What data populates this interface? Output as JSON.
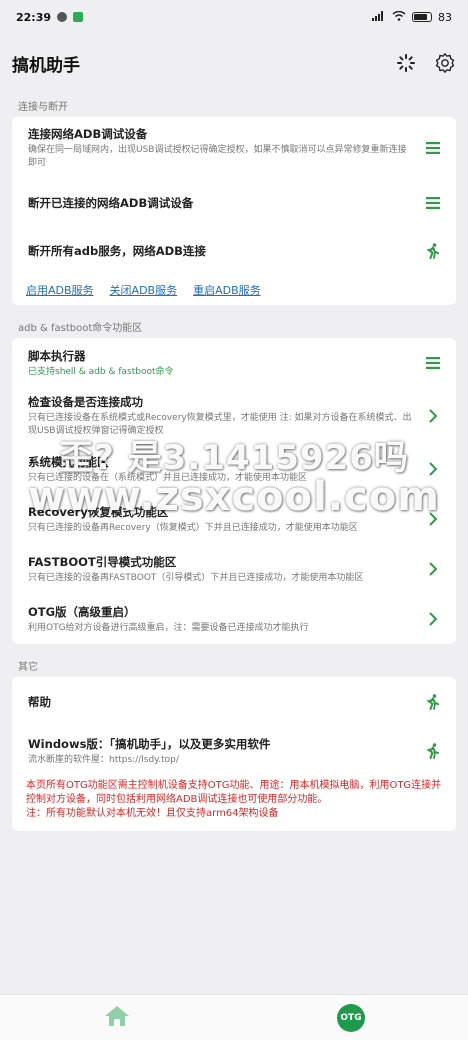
{
  "status_bar": {
    "time": "22:39",
    "battery": "83"
  },
  "app": {
    "title": "搞机助手",
    "loading_icon": "loading-icon",
    "settings_icon": "gear-icon"
  },
  "sections": {
    "connect": {
      "label": "连接与断开",
      "items": [
        {
          "title": "连接网络ADB调试设备",
          "subtitle": "确保在同一局域网内，出现USB调试授权记得确定授权，如果不慎取消可以点异常修复重新连接即可",
          "icon": "menu-icon"
        },
        {
          "title": "断开已连接的网络ADB调试设备",
          "subtitle": "",
          "icon": "menu-icon"
        },
        {
          "title": "断开所有adb服务，网络ADB连接",
          "subtitle": "",
          "icon": "run-icon"
        }
      ],
      "links": [
        "启用ADB服务",
        "关闭ADB服务",
        "重启ADB服务"
      ]
    },
    "adb": {
      "label": "adb & fastboot命令功能区",
      "items": [
        {
          "title": "脚本执行器",
          "subtitle": "已支持shell & adb & fastboot命令",
          "icon": "menu-icon"
        },
        {
          "title": "检查设备是否连接成功",
          "subtitle": "只有已连接设备在系统模式或Recovery恢复模式里，才能使用 注: 如果对方设备在系统模式、出现USB调试授权弹窗记得确定授权",
          "icon": "chevron-right-icon"
        },
        {
          "title": "系统模式功能区",
          "subtitle": "只有已连接的设备在（系统模式）并且已连接成功，才能使用本功能区",
          "icon": "chevron-right-icon"
        },
        {
          "title": "Recovery恢复模式功能区",
          "subtitle": "只有已连接的设备再Recovery（恢复模式）下并且已连接成功，才能使用本功能区",
          "icon": "chevron-right-icon"
        },
        {
          "title": "FASTBOOT引导模式功能区",
          "subtitle": "只有已连接的设备再FASTBOOT（引导模式）下并且已连接成功，才能使用本功能区",
          "icon": "chevron-right-icon"
        },
        {
          "title": "OTG版（高级重启）",
          "subtitle": "利用OTG给对方设备进行高级重启，注：需要设备已连接成功才能执行",
          "icon": "chevron-right-icon"
        }
      ]
    },
    "other": {
      "label": "其它",
      "items": [
        {
          "title": "帮助",
          "subtitle": "",
          "icon": "run-icon"
        },
        {
          "title": "Windows版：「搞机助手」，以及更多实用软件",
          "subtitle": "流水断崖的软件屋：https://lsdy.top/",
          "icon": "run-icon"
        }
      ],
      "notice": "本页所有OTG功能区需主控制机设备支持OTG功能、用途：用本机模拟电脑，利用OTG连接并控制对方设备，同时包括利用网络ADB调试连接也可使用部分功能。",
      "notice2": "注：所有功能默认对本机无效！且仅支持arm64架构设备"
    }
  },
  "watermark": {
    "line1": "歪?  是3.1415926吗",
    "line2": "www.zsxcool.com"
  },
  "bottom_nav": {
    "home_icon": "home-icon",
    "otg_label": "OTG"
  },
  "colors": {
    "accent": "#2e9a4a",
    "link": "#1e6fc4",
    "notice": "#e02424"
  }
}
